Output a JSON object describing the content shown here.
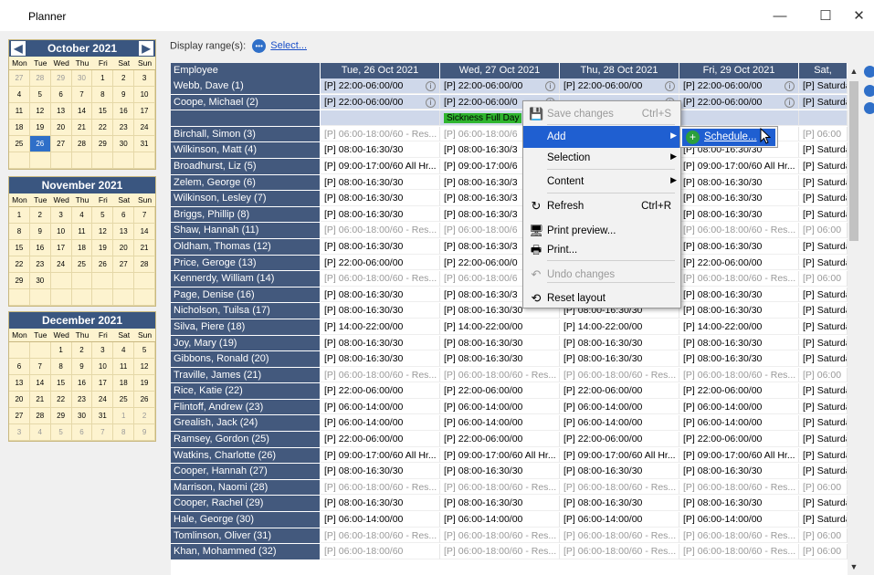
{
  "window": {
    "title": "Planner",
    "minimize": "—",
    "maximize": "☐",
    "close": "✕"
  },
  "calendars": [
    {
      "month": "October 2021",
      "dows": [
        "Mon",
        "Tue",
        "Wed",
        "Thu",
        "Fri",
        "Sat",
        "Sun"
      ],
      "days": [
        [
          "27",
          1
        ],
        [
          "28",
          1
        ],
        [
          "29",
          1
        ],
        [
          "30",
          1
        ],
        [
          "1",
          0
        ],
        [
          "2",
          0
        ],
        [
          "3",
          0
        ],
        [
          "4",
          0
        ],
        [
          "5",
          0
        ],
        [
          "6",
          0
        ],
        [
          "7",
          0
        ],
        [
          "8",
          0
        ],
        [
          "9",
          0
        ],
        [
          "10",
          0
        ],
        [
          "11",
          0
        ],
        [
          "12",
          0
        ],
        [
          "13",
          0
        ],
        [
          "14",
          0
        ],
        [
          "15",
          0
        ],
        [
          "16",
          0
        ],
        [
          "17",
          0
        ],
        [
          "18",
          0
        ],
        [
          "19",
          0
        ],
        [
          "20",
          0
        ],
        [
          "21",
          0
        ],
        [
          "22",
          0
        ],
        [
          "23",
          0
        ],
        [
          "24",
          0
        ],
        [
          "25",
          0
        ],
        [
          "26",
          2
        ],
        [
          "27",
          0
        ],
        [
          "28",
          0
        ],
        [
          "29",
          0
        ],
        [
          "30",
          0
        ],
        [
          "31",
          0
        ],
        [
          "",
          0
        ],
        [
          "",
          0
        ],
        [
          "",
          0
        ],
        [
          "",
          0
        ],
        [
          "",
          0
        ],
        [
          "",
          0
        ],
        [
          "",
          0
        ]
      ]
    },
    {
      "month": "November 2021",
      "dows": [
        "Mon",
        "Tue",
        "Wed",
        "Thu",
        "Fri",
        "Sat",
        "Sun"
      ],
      "days": [
        [
          "1",
          0
        ],
        [
          "2",
          0
        ],
        [
          "3",
          0
        ],
        [
          "4",
          0
        ],
        [
          "5",
          0
        ],
        [
          "6",
          0
        ],
        [
          "7",
          0
        ],
        [
          "8",
          0
        ],
        [
          "9",
          0
        ],
        [
          "10",
          0
        ],
        [
          "11",
          0
        ],
        [
          "12",
          0
        ],
        [
          "13",
          0
        ],
        [
          "14",
          0
        ],
        [
          "15",
          0
        ],
        [
          "16",
          0
        ],
        [
          "17",
          0
        ],
        [
          "18",
          0
        ],
        [
          "19",
          0
        ],
        [
          "20",
          0
        ],
        [
          "21",
          0
        ],
        [
          "22",
          0
        ],
        [
          "23",
          0
        ],
        [
          "24",
          0
        ],
        [
          "25",
          0
        ],
        [
          "26",
          0
        ],
        [
          "27",
          0
        ],
        [
          "28",
          0
        ],
        [
          "29",
          0
        ],
        [
          "30",
          0
        ],
        [
          "",
          0
        ],
        [
          "",
          0
        ],
        [
          "",
          0
        ],
        [
          "",
          0
        ],
        [
          "",
          0
        ],
        [
          "",
          0
        ],
        [
          "",
          0
        ],
        [
          "",
          0
        ],
        [
          "",
          0
        ],
        [
          "",
          0
        ],
        [
          "",
          0
        ],
        [
          "",
          0
        ]
      ]
    },
    {
      "month": "December 2021",
      "dows": [
        "Mon",
        "Tue",
        "Wed",
        "Thu",
        "Fri",
        "Sat",
        "Sun"
      ],
      "days": [
        [
          "",
          0
        ],
        [
          "",
          0
        ],
        [
          "1",
          0
        ],
        [
          "2",
          0
        ],
        [
          "3",
          0
        ],
        [
          "4",
          0
        ],
        [
          "5",
          0
        ],
        [
          "6",
          0
        ],
        [
          "7",
          0
        ],
        [
          "8",
          0
        ],
        [
          "9",
          0
        ],
        [
          "10",
          0
        ],
        [
          "11",
          0
        ],
        [
          "12",
          0
        ],
        [
          "13",
          0
        ],
        [
          "14",
          0
        ],
        [
          "15",
          0
        ],
        [
          "16",
          0
        ],
        [
          "17",
          0
        ],
        [
          "18",
          0
        ],
        [
          "19",
          0
        ],
        [
          "20",
          0
        ],
        [
          "21",
          0
        ],
        [
          "22",
          0
        ],
        [
          "23",
          0
        ],
        [
          "24",
          0
        ],
        [
          "25",
          0
        ],
        [
          "26",
          0
        ],
        [
          "27",
          0
        ],
        [
          "28",
          0
        ],
        [
          "29",
          0
        ],
        [
          "30",
          0
        ],
        [
          "31",
          0
        ],
        [
          "1",
          1
        ],
        [
          "2",
          1
        ],
        [
          "3",
          1
        ],
        [
          "4",
          1
        ],
        [
          "5",
          1
        ],
        [
          "6",
          1
        ],
        [
          "7",
          1
        ],
        [
          "8",
          1
        ],
        [
          "9",
          1
        ]
      ]
    }
  ],
  "toolbar": {
    "label": "Display range(s):",
    "icon": "•••",
    "link": "Select..."
  },
  "grid": {
    "headers": [
      "Employee",
      "Tue, 26 Oct 2021",
      "Wed, 27 Oct 2021",
      "Thu, 28 Oct 2021",
      "Fri, 29 Oct 2021",
      "Sat,"
    ],
    "rows": [
      {
        "name": "Webb, Dave (1)",
        "cells": [
          "[P] 22:00-06:00/00",
          "[P] 22:00-06:00/00",
          "[P] 22:00-06:00/00",
          "[P] 22:00-06:00/00",
          "[P] Saturda"
        ],
        "info": true,
        "hl": true
      },
      {
        "name": "Coope, Michael (2)",
        "cells": [
          "[P] 22:00-06:00/00",
          "[P] 22:00-06:00/0",
          "",
          "[P] 22:00-06:00/00",
          "[P] Saturda"
        ],
        "info": true,
        "hl": true
      },
      {
        "name": "",
        "cells": [
          "",
          "Sickness Full Day",
          "",
          "",
          ""
        ],
        "sick": true,
        "hl": true
      },
      {
        "name": "Birchall, Simon (3)",
        "cells": [
          "[P] 06:00-18:00/60 - Res...",
          "[P] 06:00-18:00/6",
          "",
          "",
          "[P] 06:00"
        ],
        "g": true
      },
      {
        "name": "Wilkinson, Matt (4)",
        "cells": [
          "[P] 08:00-16:30/30",
          "[P] 08:00-16:30/3",
          "",
          "[P] 08:00-16:30/30",
          "[P] Saturda"
        ]
      },
      {
        "name": "Broadhurst, Liz (5)",
        "cells": [
          "[P] 09:00-17:00/60 All Hr...",
          "[P] 09:00-17:00/6",
          "",
          "[P] 09:00-17:00/60 All Hr...",
          "[P] Saturda"
        ]
      },
      {
        "name": "Zelem, George (6)",
        "cells": [
          "[P] 08:00-16:30/30",
          "[P] 08:00-16:30/3",
          "",
          "[P] 08:00-16:30/30",
          "[P] Saturda"
        ]
      },
      {
        "name": "Wilkinson, Lesley (7)",
        "cells": [
          "[P] 08:00-16:30/30",
          "[P] 08:00-16:30/3",
          "",
          "[P] 08:00-16:30/30",
          "[P] Saturda"
        ]
      },
      {
        "name": "Briggs, Phillip (8)",
        "cells": [
          "[P] 08:00-16:30/30",
          "[P] 08:00-16:30/3",
          "",
          "[P] 08:00-16:30/30",
          "[P] Saturda"
        ]
      },
      {
        "name": "Shaw, Hannah (11)",
        "cells": [
          "[P] 06:00-18:00/60 - Res...",
          "[P] 06:00-18:00/6",
          "",
          "[P] 06:00-18:00/60 - Res...",
          "[P] 06:00"
        ],
        "g": true
      },
      {
        "name": "Oldham, Thomas (12)",
        "cells": [
          "[P] 08:00-16:30/30",
          "[P] 08:00-16:30/3",
          "",
          "[P] 08:00-16:30/30",
          "[P] Saturda"
        ]
      },
      {
        "name": "Price, Geroge (13)",
        "cells": [
          "[P] 22:00-06:00/00",
          "[P] 22:00-06:00/0",
          "",
          "[P] 22:00-06:00/00",
          "[P] Saturda"
        ]
      },
      {
        "name": "Kennerdy, William (14)",
        "cells": [
          "[P] 06:00-18:00/60 - Res...",
          "[P] 06:00-18:00/6",
          "",
          "[P] 06:00-18:00/60 - Res...",
          "[P] 06:00"
        ],
        "g": true
      },
      {
        "name": "Page, Denise (16)",
        "cells": [
          "[P] 08:00-16:30/30",
          "[P] 08:00-16:30/3",
          "",
          "[P] 08:00-16:30/30",
          "[P] Saturda"
        ]
      },
      {
        "name": "Nicholson, Tuilsa (17)",
        "cells": [
          "[P] 08:00-16:30/30",
          "[P] 08:00-16:30/30",
          "[P] 08:00-16:30/30",
          "[P] 08:00-16:30/30",
          "[P] Saturda"
        ]
      },
      {
        "name": "Silva, Piere (18)",
        "cells": [
          "[P] 14:00-22:00/00",
          "[P] 14:00-22:00/00",
          "[P] 14:00-22:00/00",
          "[P] 14:00-22:00/00",
          "[P] Saturda"
        ]
      },
      {
        "name": "Joy, Mary (19)",
        "cells": [
          "[P] 08:00-16:30/30",
          "[P] 08:00-16:30/30",
          "[P] 08:00-16:30/30",
          "[P] 08:00-16:30/30",
          "[P] Saturda"
        ]
      },
      {
        "name": "Gibbons, Ronald (20)",
        "cells": [
          "[P] 08:00-16:30/30",
          "[P] 08:00-16:30/30",
          "[P] 08:00-16:30/30",
          "[P] 08:00-16:30/30",
          "[P] Saturda"
        ]
      },
      {
        "name": "Traville, James (21)",
        "cells": [
          "[P] 06:00-18:00/60 - Res...",
          "[P] 06:00-18:00/60 - Res...",
          "[P] 06:00-18:00/60 - Res...",
          "[P] 06:00-18:00/60 - Res...",
          "[P] 06:00"
        ],
        "g": true
      },
      {
        "name": "Rice, Katie (22)",
        "cells": [
          "[P] 22:00-06:00/00",
          "[P] 22:00-06:00/00",
          "[P] 22:00-06:00/00",
          "[P] 22:00-06:00/00",
          "[P] Saturda"
        ]
      },
      {
        "name": "Flintoff, Andrew (23)",
        "cells": [
          "[P] 06:00-14:00/00",
          "[P] 06:00-14:00/00",
          "[P] 06:00-14:00/00",
          "[P] 06:00-14:00/00",
          "[P] Saturda"
        ]
      },
      {
        "name": "Grealish, Jack (24)",
        "cells": [
          "[P] 06:00-14:00/00",
          "[P] 06:00-14:00/00",
          "[P] 06:00-14:00/00",
          "[P] 06:00-14:00/00",
          "[P] Saturda"
        ]
      },
      {
        "name": "Ramsey, Gordon (25)",
        "cells": [
          "[P] 22:00-06:00/00",
          "[P] 22:00-06:00/00",
          "[P] 22:00-06:00/00",
          "[P] 22:00-06:00/00",
          "[P] Saturda"
        ]
      },
      {
        "name": "Watkins, Charlotte (26)",
        "cells": [
          "[P] 09:00-17:00/60 All Hr...",
          "[P] 09:00-17:00/60 All Hr...",
          "[P] 09:00-17:00/60 All Hr...",
          "[P] 09:00-17:00/60 All Hr...",
          "[P] Saturda"
        ]
      },
      {
        "name": "Cooper, Hannah (27)",
        "cells": [
          "[P] 08:00-16:30/30",
          "[P] 08:00-16:30/30",
          "[P] 08:00-16:30/30",
          "[P] 08:00-16:30/30",
          "[P] Saturda"
        ]
      },
      {
        "name": "Marrison, Naomi (28)",
        "cells": [
          "[P] 06:00-18:00/60 - Res...",
          "[P] 06:00-18:00/60 - Res...",
          "[P] 06:00-18:00/60 - Res...",
          "[P] 06:00-18:00/60 - Res...",
          "[P] 06:00"
        ],
        "g": true
      },
      {
        "name": "Cooper, Rachel (29)",
        "cells": [
          "[P] 08:00-16:30/30",
          "[P] 08:00-16:30/30",
          "[P] 08:00-16:30/30",
          "[P] 08:00-16:30/30",
          "[P] Saturda"
        ]
      },
      {
        "name": "Hale, George (30)",
        "cells": [
          "[P] 06:00-14:00/00",
          "[P] 06:00-14:00/00",
          "[P] 06:00-14:00/00",
          "[P] 06:00-14:00/00",
          "[P] Saturda"
        ]
      },
      {
        "name": "Tomlinson, Oliver (31)",
        "cells": [
          "[P] 06:00-18:00/60 - Res...",
          "[P] 06:00-18:00/60 - Res...",
          "[P] 06:00-18:00/60 - Res...",
          "[P] 06:00-18:00/60 - Res...",
          "[P] 06:00"
        ],
        "g": true
      },
      {
        "name": "Khan, Mohammed (32)",
        "cells": [
          "[P] 06:00-18:00/60",
          "[P] 06:00-18:00/60 - Res...",
          "[P] 06:00-18:00/60 - Res...",
          "[P] 06:00-18:00/60 - Res...",
          "[P] 06:00"
        ],
        "g": true
      }
    ]
  },
  "context_menu": {
    "items": [
      {
        "label": "Save changes",
        "shortcut": "Ctrl+S",
        "icon": "💾",
        "disabled": true
      },
      {
        "label": "Add",
        "arrow": "▶",
        "active": true
      },
      {
        "label": "Selection",
        "arrow": "▶"
      },
      {
        "label": "Content",
        "arrow": "▶"
      },
      {
        "label": "Refresh",
        "shortcut": "Ctrl+R",
        "icon": "↻"
      },
      {
        "label": "Print preview...",
        "icon": "🖥"
      },
      {
        "label": "Print...",
        "icon": "🖶"
      },
      {
        "label": "Undo changes",
        "icon": "↶",
        "disabled": true
      },
      {
        "label": "Reset layout",
        "icon": "⟲"
      }
    ]
  },
  "submenu": {
    "label": "Schedule...",
    "icon": "+"
  },
  "colors": {
    "header": "#43597d",
    "accent": "#1f5fd1",
    "sick": "#2fb52f",
    "calendar_bg": "#fdf3cf"
  }
}
